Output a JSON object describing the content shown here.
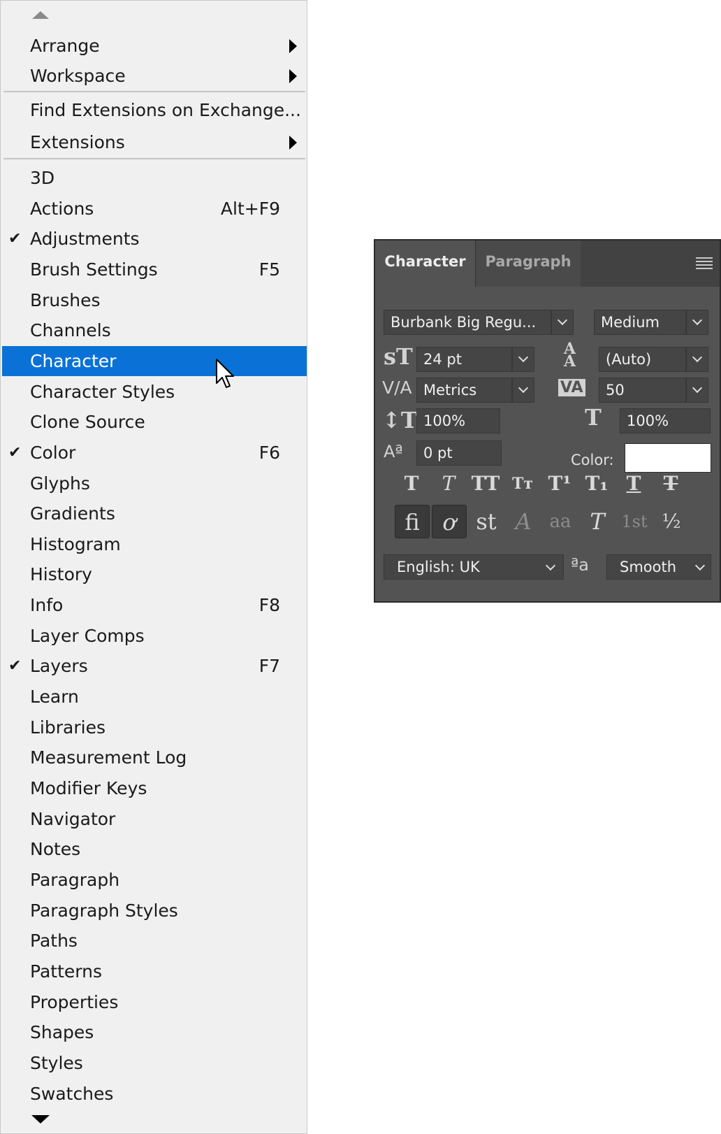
{
  "menu": {
    "arrange": "Arrange",
    "workspace": "Workspace",
    "find_extensions": "Find Extensions on Exchange...",
    "extensions": "Extensions",
    "items": [
      {
        "label": "3D",
        "shortcut": "",
        "checked": false
      },
      {
        "label": "Actions",
        "shortcut": "Alt+F9",
        "checked": false
      },
      {
        "label": "Adjustments",
        "shortcut": "",
        "checked": true
      },
      {
        "label": "Brush Settings",
        "shortcut": "F5",
        "checked": false
      },
      {
        "label": "Brushes",
        "shortcut": "",
        "checked": false
      },
      {
        "label": "Channels",
        "shortcut": "",
        "checked": false
      },
      {
        "label": "Character",
        "shortcut": "",
        "checked": false
      },
      {
        "label": "Character Styles",
        "shortcut": "",
        "checked": false
      },
      {
        "label": "Clone Source",
        "shortcut": "",
        "checked": false
      },
      {
        "label": "Color",
        "shortcut": "F6",
        "checked": true
      },
      {
        "label": "Glyphs",
        "shortcut": "",
        "checked": false
      },
      {
        "label": "Gradients",
        "shortcut": "",
        "checked": false
      },
      {
        "label": "Histogram",
        "shortcut": "",
        "checked": false
      },
      {
        "label": "History",
        "shortcut": "",
        "checked": false
      },
      {
        "label": "Info",
        "shortcut": "F8",
        "checked": false
      },
      {
        "label": "Layer Comps",
        "shortcut": "",
        "checked": false
      },
      {
        "label": "Layers",
        "shortcut": "F7",
        "checked": true
      },
      {
        "label": "Learn",
        "shortcut": "",
        "checked": false
      },
      {
        "label": "Libraries",
        "shortcut": "",
        "checked": false
      },
      {
        "label": "Measurement Log",
        "shortcut": "",
        "checked": false
      },
      {
        "label": "Modifier Keys",
        "shortcut": "",
        "checked": false
      },
      {
        "label": "Navigator",
        "shortcut": "",
        "checked": false
      },
      {
        "label": "Notes",
        "shortcut": "",
        "checked": false
      },
      {
        "label": "Paragraph",
        "shortcut": "",
        "checked": false
      },
      {
        "label": "Paragraph Styles",
        "shortcut": "",
        "checked": false
      },
      {
        "label": "Paths",
        "shortcut": "",
        "checked": false
      },
      {
        "label": "Patterns",
        "shortcut": "",
        "checked": false
      },
      {
        "label": "Properties",
        "shortcut": "",
        "checked": false
      },
      {
        "label": "Shapes",
        "shortcut": "",
        "checked": false
      },
      {
        "label": "Styles",
        "shortcut": "",
        "checked": false
      },
      {
        "label": "Swatches",
        "shortcut": "",
        "checked": false
      }
    ],
    "highlighted": "Character",
    "check_glyph": "✔"
  },
  "panel": {
    "tabs": {
      "active": "Character",
      "inactive": "Paragraph"
    },
    "font_family": "Burbank Big Regu...",
    "font_style": "Medium",
    "font_size": "24 pt",
    "leading": "(Auto)",
    "kerning": "Metrics",
    "tracking": "50",
    "vertical_scale": "100%",
    "horizontal_scale": "100%",
    "baseline_shift": "0 pt",
    "color_label": "Color:",
    "color_value": "#ffffff",
    "language": "English: UK",
    "antialias": "Smooth",
    "type_style_buttons": [
      "T",
      "T",
      "TT",
      "Tт",
      "T¹",
      "T₁",
      "T",
      "T"
    ],
    "opentype_buttons": [
      "fi",
      "ơ",
      "st",
      "A",
      "aa",
      "T",
      "1st",
      "½"
    ]
  }
}
